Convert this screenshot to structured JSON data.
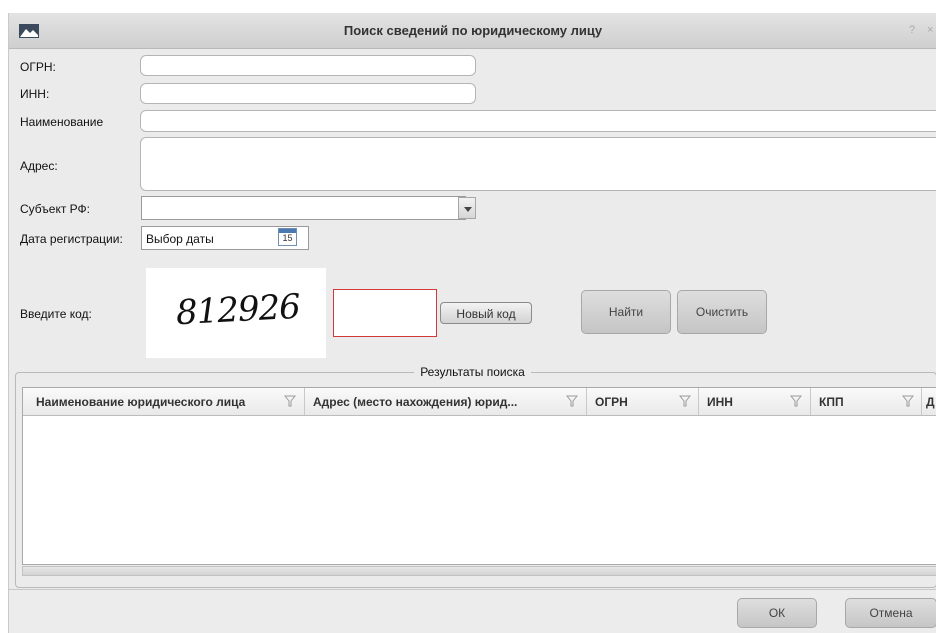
{
  "window": {
    "title": "Поиск сведений по юридическому лицу",
    "help": "?",
    "close": "×"
  },
  "form": {
    "ogrn_label": "ОГРН:",
    "inn_label": "ИНН:",
    "name_label": "Наименование",
    "address_label": "Адрес:",
    "subject_label": "Субъект РФ:",
    "reg_date_label": "Дата регистрации:",
    "reg_date_placeholder": "Выбор даты",
    "calendar_day": "15",
    "code_label": "Введите код:",
    "captcha_text": "812926",
    "ogrn_value": "",
    "inn_value": "",
    "name_value": "",
    "address_value": "",
    "subject_value": "",
    "code_value": ""
  },
  "buttons": {
    "new_code": "Новый код",
    "search": "Найти",
    "clear": "Очистить",
    "ok": "ОК",
    "cancel": "Отмена"
  },
  "results": {
    "title": "Результаты поиска",
    "columns": [
      "Наименование юридического лица",
      "Адрес (место нахождения) юрид...",
      "ОГРН",
      "ИНН",
      "КПП",
      "Д"
    ],
    "rows": []
  }
}
